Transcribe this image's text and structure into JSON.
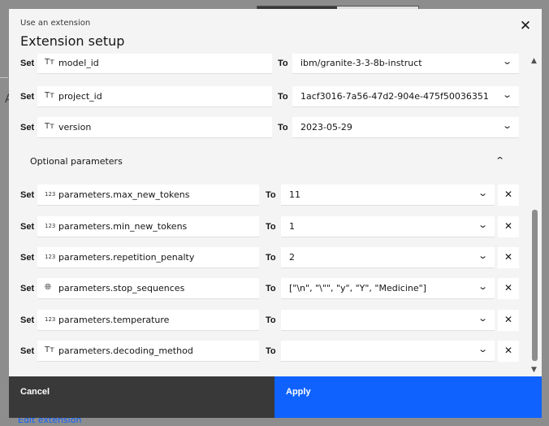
{
  "background": {
    "link": "Edit extension"
  },
  "modal": {
    "label": "Use an extension",
    "title": "Extension setup",
    "close_icon": "close-icon"
  },
  "rows": [
    {
      "set": "Set",
      "field": "model_id",
      "icon": "text-type-icon",
      "to": "To",
      "value": "ibm/granite-3-3-8b-instruct"
    },
    {
      "set": "Set",
      "field": "project_id",
      "icon": "text-type-icon",
      "to": "To",
      "value": "1acf3016-7a56-47d2-904e-475f50036351"
    },
    {
      "set": "Set",
      "field": "version",
      "icon": "text-type-icon",
      "to": "To",
      "value": "2023-05-29"
    }
  ],
  "optional": {
    "title": "Optional parameters",
    "rows": [
      {
        "set": "Set",
        "field": "parameters.max_new_tokens",
        "icon": "number-type-icon",
        "to": "To",
        "value": "11"
      },
      {
        "set": "Set",
        "field": "parameters.min_new_tokens",
        "icon": "number-type-icon",
        "to": "To",
        "value": "1"
      },
      {
        "set": "Set",
        "field": "parameters.repetition_penalty",
        "icon": "number-type-icon",
        "to": "To",
        "value": "2"
      },
      {
        "set": "Set",
        "field": "parameters.stop_sequences",
        "icon": "globe-icon",
        "to": "To",
        "value": "[\"\\n\", \"\\\"\", \"y\", \"Y\", \"Medicine\"]"
      },
      {
        "set": "Set",
        "field": "parameters.temperature",
        "icon": "number-type-icon",
        "to": "To",
        "value": ""
      },
      {
        "set": "Set",
        "field": "parameters.decoding_method",
        "icon": "text-type-icon",
        "to": "To",
        "value": ""
      }
    ]
  },
  "footer": {
    "cancel": "Cancel",
    "apply": "Apply"
  },
  "colors": {
    "primary": "#0f62fe",
    "secondary": "#393939",
    "surface": "#f4f4f4"
  }
}
